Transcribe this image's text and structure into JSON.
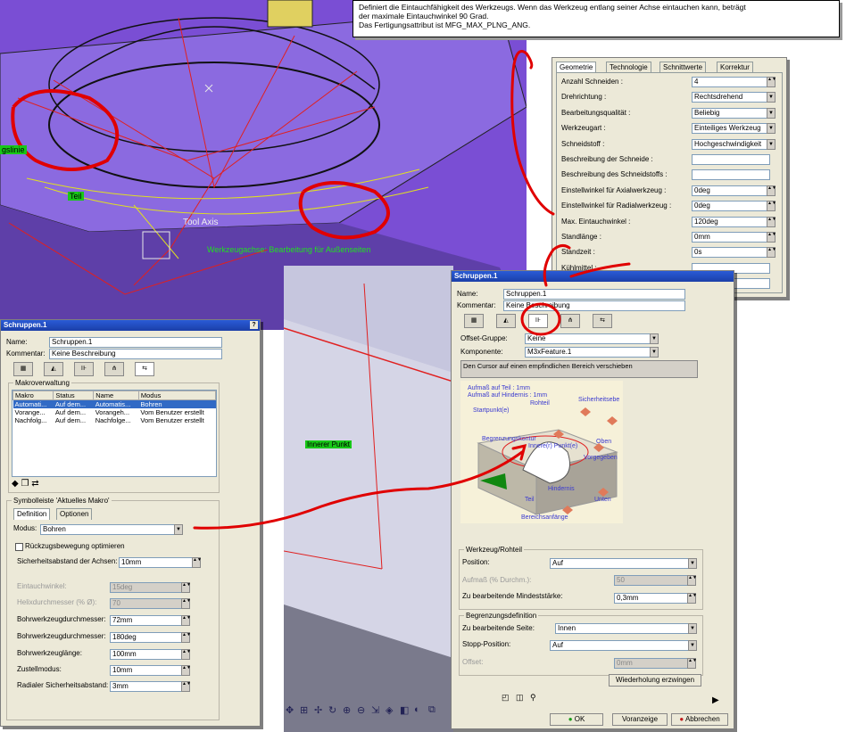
{
  "tooltip": {
    "line1": "Definiert die Eintauchfähigkeit des Werkzeugs. Wenn das Werkzeug entlang seiner Achse eintauchen kann, beträgt",
    "line2": "der maximale Eintauchwinkel 90 Grad.",
    "line3": "Das Fertigungsattribut ist MFG_MAX_PLNG_ANG."
  },
  "viewport": {
    "tag_left": "gslinie",
    "tag_teil": "Teil",
    "tool_axis": "Tool Axis",
    "green_text": "Werkzeugachse: Bearbeitung für Außenseiten",
    "tag_inner": "Innerer Punkt",
    "accent": "#7a4ed4"
  },
  "toolpanel": {
    "tabs": [
      "Geometrie",
      "Technologie",
      "Schnittwerte",
      "Korrektur"
    ],
    "rows": [
      {
        "label": "Anzahl Schneiden :",
        "value": "4",
        "ctrl": "spin"
      },
      {
        "label": "Drehrichtung :",
        "value": "Rechtsdrehend",
        "ctrl": "dd"
      },
      {
        "label": "Bearbeitungsqualität :",
        "value": "Beliebig",
        "ctrl": "dd"
      },
      {
        "label": "Werkzeugart :",
        "value": "Einteiliges Werkzeug",
        "ctrl": "dd"
      },
      {
        "label": "Schneidstoff :",
        "value": "Hochgeschwindigkeit",
        "ctrl": "dd"
      },
      {
        "label": "Beschreibung der Schneide :",
        "value": "",
        "ctrl": "none"
      },
      {
        "label": "Beschreibung des Schneidstoffs :",
        "value": "",
        "ctrl": "none"
      },
      {
        "label": "Einstellwinkel für Axialwerkzeug :",
        "value": "0deg",
        "ctrl": "spin"
      },
      {
        "label": "Einstellwinkel für Radialwerkzeug :",
        "value": "0deg",
        "ctrl": "spin"
      },
      {
        "label": "Max. Eintauchwinkel :",
        "value": "120deg",
        "ctrl": "spin"
      },
      {
        "label": "Standlänge :",
        "value": "0mm",
        "ctrl": "spin"
      },
      {
        "label": "Standzeit :",
        "value": "0s",
        "ctrl": "spin"
      },
      {
        "label": "Kühlmittel :",
        "value": "",
        "ctrl": "none"
      },
      {
        "label": "Gewicht :",
        "value": "",
        "ctrl": "none"
      }
    ]
  },
  "leftdlg": {
    "title": "Schruppen.1",
    "close": "?",
    "name_label": "Name:",
    "name_value": "Schruppen.1",
    "comment_label": "Kommentar:",
    "comment_value": "Keine Beschreibung",
    "macro_group": "Makroverwaltung",
    "macro_headers": [
      "Makro",
      "Status",
      "Name",
      "Modus"
    ],
    "macro_rows": [
      [
        "Automati...",
        "Auf dem...",
        "Automatis...",
        "Bohren"
      ],
      [
        "Vorange...",
        "Auf dem...",
        "Vorangeh...",
        "Vom Benutzer erstellt"
      ],
      [
        "Nachfolg...",
        "Auf dem...",
        "Nachfolge...",
        "Vom Benutzer erstellt"
      ]
    ],
    "toolbar_group": "Symbolleiste 'Aktuelles Makro'",
    "tabs": [
      "Definition",
      "Optionen"
    ],
    "modus_label": "Modus:",
    "modus_value": "Bohren",
    "checkbox_label": "Rückzugsbewegung optimieren",
    "params": [
      {
        "label": "Sicherheitsabstand der Achsen:",
        "value": "10mm",
        "disabled": false
      },
      {
        "label": "Eintauchwinkel:",
        "value": "15deg",
        "disabled": true
      },
      {
        "label": "Helixdurchmesser (% Ø):",
        "value": "70",
        "disabled": true
      },
      {
        "label": "Bohrwerkzeugdurchmesser:",
        "value": "72mm",
        "disabled": false
      },
      {
        "label": "Bohrwerkzeugdurchmesser:",
        "value": "180deg",
        "disabled": false
      },
      {
        "label": "Bohrwerkzeuglänge:",
        "value": "100mm",
        "disabled": false
      },
      {
        "label": "Zustellmodus:",
        "value": "10mm",
        "disabled": false
      },
      {
        "label": "Radialer Sicherheitsabstand:",
        "value": "3mm",
        "disabled": false
      }
    ]
  },
  "rightdlg": {
    "title": "Schruppen.1",
    "name_label": "Name:",
    "name_value": "Schruppen.1",
    "comment_label": "Kommentar:",
    "comment_value": "Keine Beschreibung",
    "offset_label": "Offset-Gruppe:",
    "offset_value": "Keine",
    "komp_label": "Komponente:",
    "komp_value": "M3xFeature.1",
    "hint": "Den Cursor auf einen empfindlichen Bereich verschieben",
    "diagram": {
      "aufmass_teil": "Aufmaß auf Teil : 1mm",
      "aufmass_hind": "Aufmaß auf Hindernis : 1mm",
      "rohteil": "Rohteil",
      "sicherheit": "Sicherheitsebe",
      "startpunkt": "Startpunkt(e)",
      "begrenzung": "Begrenzungskontur",
      "inner": "Innere(r) Punkt(e)",
      "oben": "Oben",
      "vorgegeben": "Vorgegeben",
      "hindernis": "Hindernis",
      "teil": "Teil",
      "unten": "Unten",
      "bereich": "Bereichsanfänge"
    },
    "wz_group": "Werkzeug/Rohteil",
    "position_label": "Position:",
    "position_value": "Auf",
    "aufmass_label": "Aufmaß (% Durchm.):",
    "aufmass_value": "50",
    "mindest_label": "Zu bearbeitende Mindeststärke:",
    "mindest_value": "0,3mm",
    "begr_group": "Begrenzungsdefinition",
    "seite_label": "Zu bearbeitende Seite:",
    "seite_value": "Innen",
    "stopp_label": "Stopp-Position:",
    "stopp_value": "Auf",
    "offset2_label": "Offset:",
    "offset2_value": "0mm",
    "repeat_btn": "Wiederholung erzwingen",
    "ok": "OK",
    "preview": "Voranzeige",
    "cancel": "Abbrechen"
  }
}
